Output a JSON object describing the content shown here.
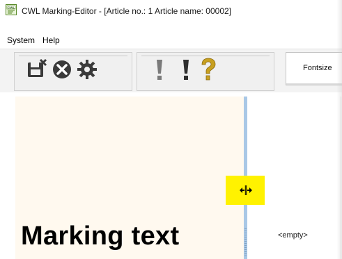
{
  "window": {
    "title": "CWL Marking-Editor - [Article no.: 1    Article name: 00002]"
  },
  "menu": {
    "items": [
      {
        "label": "System"
      },
      {
        "label": "Help"
      }
    ]
  },
  "toolbar": {
    "buttons": [
      {
        "icon": "save-close-icon"
      },
      {
        "icon": "cancel-icon"
      },
      {
        "icon": "settings-gear-icon"
      },
      {
        "icon": "exclamation-gray-icon"
      },
      {
        "icon": "exclamation-dark-icon"
      },
      {
        "icon": "help-question-icon"
      }
    ],
    "fontsize_label": "Fontsize"
  },
  "editor": {
    "marking_text": "Marking text",
    "right_panel_text": "<empty>"
  },
  "colors": {
    "left_panel_bg": "#fff9ef",
    "splitter": "#a9c8e6",
    "cursor_highlight": "#fff200",
    "question_icon": "#c8a020"
  }
}
